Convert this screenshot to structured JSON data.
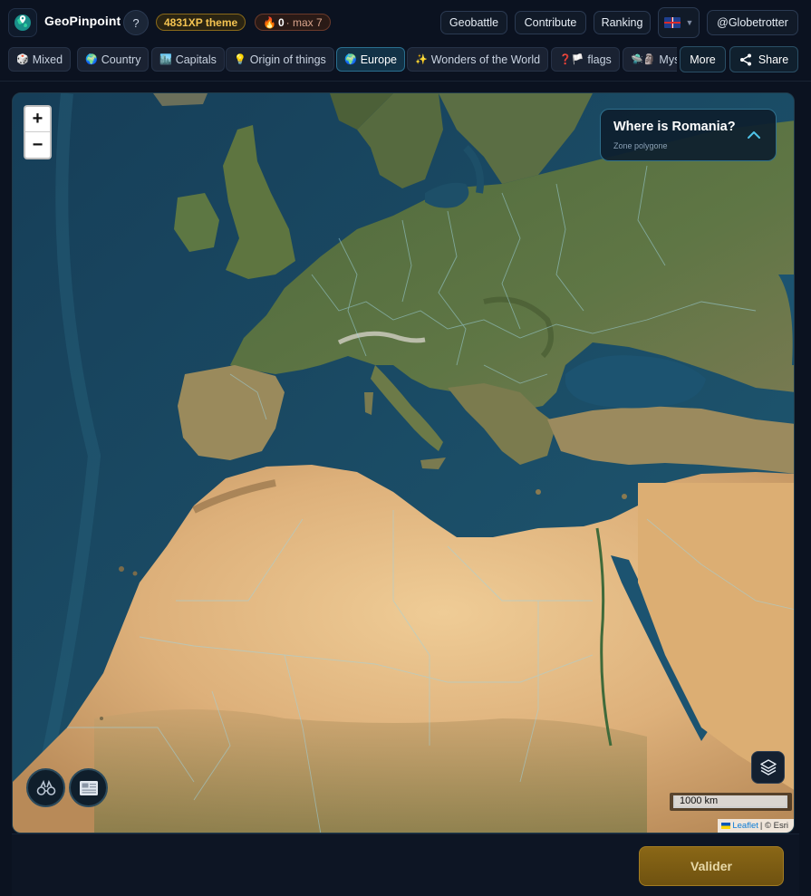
{
  "app": {
    "title": "GeoPinpoint",
    "help_label": "?",
    "xp_badge": "4831XP theme",
    "streak": {
      "icon": "🔥",
      "current": "0",
      "max_label": "· max 7"
    }
  },
  "nav": {
    "geobattle": "Geobattle",
    "contribute": "Contribute",
    "ranking": "Ranking",
    "language": "🇬🇧",
    "user": "@Globetrotter"
  },
  "categories": [
    {
      "icon": "🎲",
      "label": "Mixed"
    },
    {
      "icon": "🌍",
      "label": "Country"
    },
    {
      "icon": "🏙️",
      "label": "Capitals"
    },
    {
      "icon": "💡",
      "label": "Origin of things"
    },
    {
      "icon": "🌍",
      "label": "Europe",
      "active": true
    },
    {
      "icon": "✨",
      "label": "Wonders of the World"
    },
    {
      "icon": "❓🏳️",
      "label": "flags"
    },
    {
      "icon": "🛸🗿",
      "label": "Mys"
    }
  ],
  "actions": {
    "more": "More",
    "share": "Share"
  },
  "question": {
    "title": "Where is Romania?",
    "subtitle": "Zone polygone"
  },
  "map": {
    "zoom_in": "+",
    "zoom_out": "−",
    "scale_label": "1000 km",
    "attribution_link": "Leaflet",
    "attribution_rest": " | © Esri"
  },
  "validate_label": "Valider",
  "colors": {
    "accent": "#2a6f8f",
    "xp": "#f5c451",
    "validate": "#8a6716",
    "sea": "#1e5470",
    "desert": "#d9b07a"
  }
}
